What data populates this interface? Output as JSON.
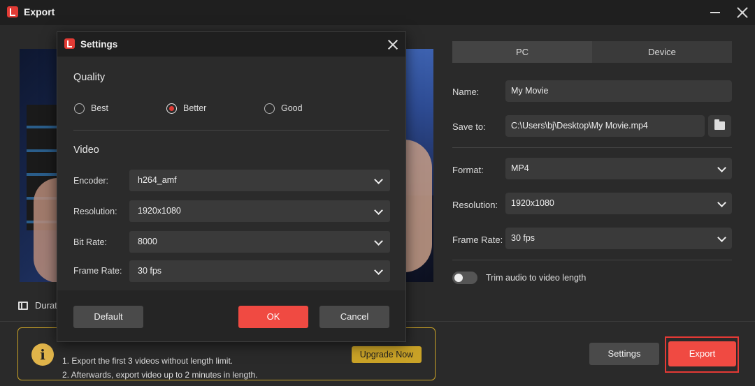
{
  "window": {
    "title": "Export"
  },
  "preview": {
    "duration_label": "Durati"
  },
  "tabs": [
    {
      "label": "PC"
    },
    {
      "label": "Device"
    }
  ],
  "form": {
    "name_label": "Name:",
    "name_value": "My Movie",
    "save_label": "Save to:",
    "save_value": "C:\\Users\\bj\\Desktop\\My Movie.mp4",
    "format_label": "Format:",
    "format_value": "MP4",
    "resolution_label": "Resolution:",
    "resolution_value": "1920x1080",
    "framerate_label": "Frame Rate:",
    "framerate_value": "30 fps",
    "trim_label": "Trim audio to video length"
  },
  "notice": {
    "line1": "1. Export the first 3 videos without length limit.",
    "line2": "2. Afterwards, export video up to 2 minutes in length.",
    "upgrade_label": "Upgrade Now"
  },
  "footer": {
    "settings_label": "Settings",
    "export_label": "Export"
  },
  "dialog": {
    "title": "Settings",
    "quality_title": "Quality",
    "quality_options": [
      {
        "label": "Best"
      },
      {
        "label": "Better"
      },
      {
        "label": "Good"
      }
    ],
    "quality_selected": "Better",
    "video_title": "Video",
    "encoder_label": "Encoder:",
    "encoder_value": "h264_amf",
    "resolution_label": "Resolution:",
    "resolution_value": "1920x1080",
    "bitrate_label": "Bit Rate:",
    "bitrate_value": "8000",
    "framerate_label": "Frame Rate:",
    "framerate_value": "30 fps",
    "default_label": "Default",
    "ok_label": "OK",
    "cancel_label": "Cancel"
  },
  "colors": {
    "accent": "#f04a42",
    "notice_border": "#c9a227",
    "background": "#2a2a2a"
  }
}
